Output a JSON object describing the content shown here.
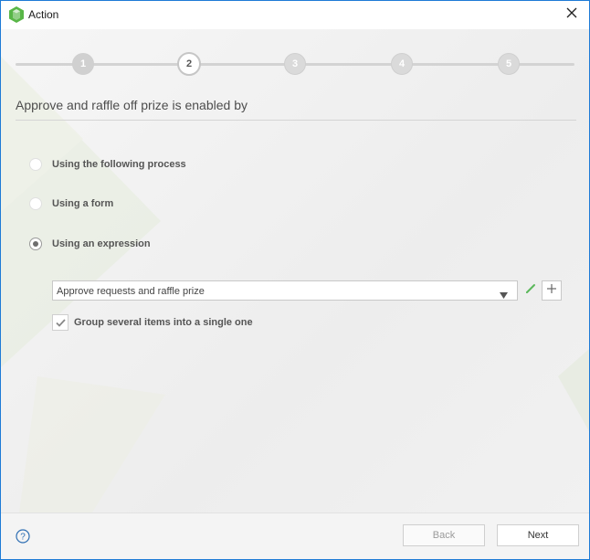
{
  "window": {
    "title": "Action",
    "icon": "app-hexagon-icon",
    "close_icon": "close-icon"
  },
  "wizard": {
    "steps": [
      {
        "label": "1",
        "state": "completed"
      },
      {
        "label": "2",
        "state": "current"
      },
      {
        "label": "3",
        "state": "pending"
      },
      {
        "label": "4",
        "state": "pending"
      },
      {
        "label": "5",
        "state": "pending"
      }
    ],
    "current_step": 2,
    "total_steps": 5
  },
  "section": {
    "heading": "Approve and raffle off prize is enabled by"
  },
  "options": [
    {
      "label": "Using the following process",
      "selected": false
    },
    {
      "label": "Using a form",
      "selected": false
    },
    {
      "label": "Using an expression",
      "selected": true
    }
  ],
  "expression_select": {
    "value": "Approve requests and raffle prize",
    "arrow_icon": "triangle-down-icon",
    "edit_icon": "pencil-icon",
    "add_icon": "plus-icon"
  },
  "group_checkbox": {
    "label": "Group several items into a single one",
    "checked": true
  },
  "footer": {
    "help_icon": "question-circle-icon",
    "back_label": "Back",
    "back_enabled": false,
    "next_label": "Next"
  },
  "colors": {
    "accent_border": "#1e7bd6",
    "app_icon_green": "#58b647",
    "edit_icon_green": "#5cb85c"
  }
}
